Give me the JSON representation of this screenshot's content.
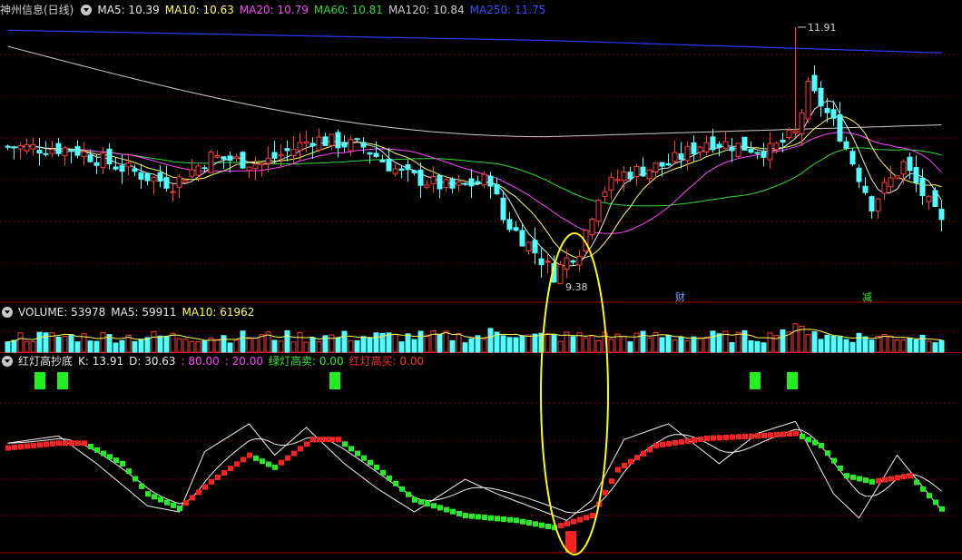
{
  "colors": {
    "up": "#ff3b3b",
    "down": "#54ffff",
    "grid": "#7a0000",
    "separator": "#b00000",
    "ma5": "#e8e8e8",
    "ma10": "#ffff55",
    "ma20": "#ff44ff",
    "ma60": "#33dd33",
    "ma120": "#cccccc",
    "ma250": "#2a3cff",
    "red_lamp": "#ff2020",
    "green_lamp": "#22ee22",
    "circle": "#ffff00"
  },
  "header": {
    "stock_name": "神州信息(日线)",
    "ma5": "MA5: 10.39",
    "ma10": "MA10: 10.63",
    "ma20": "MA20: 10.79",
    "ma60": "MA60: 10.81",
    "ma120": "MA120: 10.84",
    "ma250": "MA250: 11.75"
  },
  "price_labels": {
    "high": "11.91",
    "low": "9.38"
  },
  "markers": {
    "fin": "财",
    "reduce": "减"
  },
  "volume_header": {
    "volume": "VOLUME: 53978",
    "ma5": "MA5: 59911",
    "ma10": "MA10: 61962"
  },
  "indicator_header": {
    "name": "红灯高抄底",
    "k": "K: 13.91",
    "d": "D: 30.63",
    "upper": ": 80.00",
    "lower": ": 20.00",
    "green_sell": "绿灯高卖: 0.00",
    "red_buy": "红灯高买: 0.00"
  },
  "chart_data": {
    "type": "candlestick",
    "title": "神州信息(日线)",
    "price_range": [
      9.2,
      12.0
    ],
    "last_values": {
      "MA5": 10.39,
      "MA10": 10.63,
      "MA20": 10.79,
      "MA60": 10.81,
      "MA120": 10.84,
      "MA250": 11.75
    },
    "period_high": 11.91,
    "period_low": 9.38,
    "volume": 53978,
    "volume_ma5": 59911,
    "volume_ma10": 61962,
    "K": 13.91,
    "D": 30.63,
    "levels": [
      80.0,
      20.0
    ]
  }
}
